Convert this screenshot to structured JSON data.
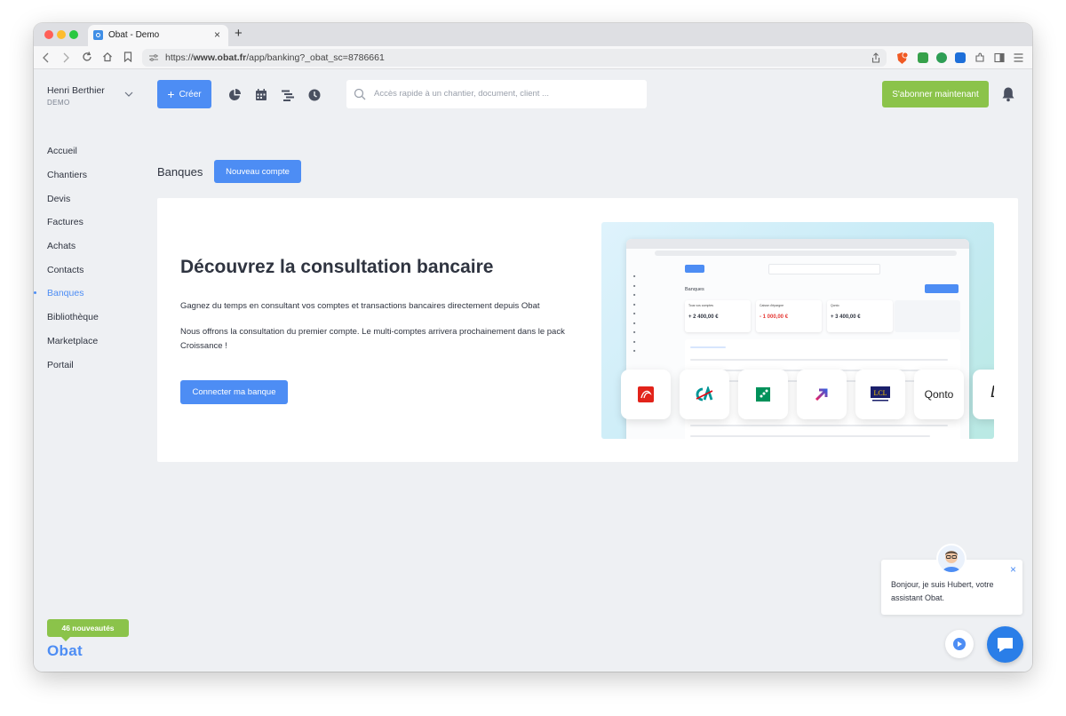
{
  "browser": {
    "tab_title": "Obat - Demo",
    "tab_close": "×",
    "new_tab": "+",
    "url_prefix": "https://",
    "url_host": "www.obat.fr",
    "url_path": "/app/banking?_obat_sc=8786661"
  },
  "header": {
    "user_name": "Henri Berthier",
    "user_org": "DEMO",
    "create_label": "Créer",
    "search_placeholder": "Accès rapide à un chantier, document, client ...",
    "subscribe_label": "S'abonner maintenant"
  },
  "sidebar": {
    "items": [
      {
        "label": "Accueil"
      },
      {
        "label": "Chantiers"
      },
      {
        "label": "Devis"
      },
      {
        "label": "Factures"
      },
      {
        "label": "Achats"
      },
      {
        "label": "Contacts"
      },
      {
        "label": "Banques",
        "active": true
      },
      {
        "label": "Bibliothèque"
      },
      {
        "label": "Marketplace"
      },
      {
        "label": "Portail"
      }
    ],
    "news_badge": "46 nouveautés",
    "logo_text": "Obat"
  },
  "page": {
    "title": "Banques",
    "new_account_label": "Nouveau compte"
  },
  "card": {
    "heading": "Découvrez la consultation bancaire",
    "paragraph1": "Gagnez du temps en consultant vos comptes et transactions bancaires directement depuis Obat",
    "paragraph2": "Nous offrons la consultation du premier compte. Le multi-comptes arrivera prochainement dans le pack Croissance !",
    "connect_label": "Connecter ma banque"
  },
  "illustration": {
    "page_title": "Banques",
    "accounts": [
      {
        "name": "Tous vos comptes",
        "amount": "+ 2 400,00 €",
        "color": "#2f3440"
      },
      {
        "name": "Caisse d'épargne",
        "amount": "- 1 000,00 €",
        "color": "#e53935"
      },
      {
        "name": "Qonto",
        "amount": "+ 3 400,00 €",
        "color": "#2f3440"
      }
    ],
    "bank_logos": [
      "caisse-epargne",
      "credit-agricole",
      "bnp-paribas",
      "revolut",
      "lcl",
      "qonto",
      "l-bank"
    ],
    "qonto_text": "Qonto",
    "lcl_text": "LCL",
    "l_text": "L"
  },
  "chat": {
    "message": "Bonjour, je suis Hubert, votre assistant Obat.",
    "close": "×"
  },
  "colors": {
    "primary": "#4d8df4",
    "green": "#8bc34a",
    "background": "#eef0f3"
  }
}
